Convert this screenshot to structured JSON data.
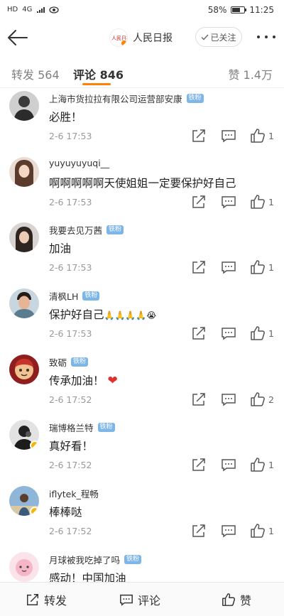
{
  "status_bar": {
    "left": [
      "HD",
      "4G"
    ],
    "battery": "58%",
    "time": "11:25"
  },
  "header": {
    "account_name": "人民日报",
    "follow_label": "已关注",
    "avatar_logo_text": "人民日报"
  },
  "tabs": [
    {
      "label": "转发 564"
    },
    {
      "label": "评论 846"
    },
    {
      "label": "赞 1.4万"
    }
  ],
  "fan_badge": "铁粉",
  "colors": {
    "accent": "#ff8200",
    "fan_badge": "#7fb6e8",
    "verified": "#f7b500",
    "heart": "#e03131"
  },
  "comments": [
    {
      "user": "上海市货拉拉有限公司运营部安康",
      "fan": true,
      "text": "必胜！",
      "time": "2-6 17:53",
      "likes": "1"
    },
    {
      "user": "yuyuyuyuqi__",
      "fan": false,
      "text": "啊啊啊啊啊天使姐姐一定要保护好自己",
      "time": "2-6 17:53",
      "likes": "1"
    },
    {
      "user": "我要去见万茜",
      "fan": true,
      "text": "加油",
      "time": "2-6 17:53",
      "likes": "1"
    },
    {
      "user": "清枫LH",
      "fan": true,
      "text": "保护好自己",
      "emoji": "🙏🙏🙏🙏😭",
      "time": "2-6 17:53",
      "likes": "1"
    },
    {
      "user": "致砺",
      "fan": true,
      "text": "传承加油！",
      "emoji": "❤",
      "time": "2-6 17:52",
      "likes": "2"
    },
    {
      "user": "瑞博格兰特",
      "fan": true,
      "verified": true,
      "text": "真好看！",
      "time": "2-6 17:52",
      "likes": "1"
    },
    {
      "user": "iflytek_程畅",
      "fan": false,
      "verified": true,
      "text": "棒棒哒",
      "time": "2-6 17:52",
      "likes": "1"
    },
    {
      "user": "月球被我吃掉了吗",
      "fan": true,
      "text": "感动！中国加油",
      "time": "",
      "likes": ""
    }
  ],
  "bottom_bar": {
    "repost": "转发",
    "comment": "评论",
    "like": "赞"
  }
}
